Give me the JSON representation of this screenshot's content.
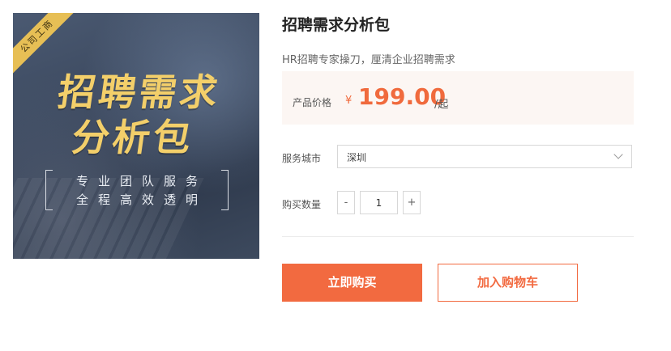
{
  "product": {
    "title": "招聘需求分析包",
    "subtitle": "HR招聘专家操刀，厘清企业招聘需求",
    "image": {
      "ribbon_text": "公司工商",
      "headline_line1": "招聘需求",
      "headline_line2": "分析包",
      "tagline_line1": "专业团队服务",
      "tagline_line2": "全程高效透明"
    }
  },
  "price": {
    "label": "产品价格",
    "currency": "¥",
    "value": "199.00",
    "unit": "/起"
  },
  "city": {
    "label": "服务城市",
    "selected": "深圳"
  },
  "quantity": {
    "label": "购买数量",
    "minus": "-",
    "value": "1",
    "plus": "+"
  },
  "actions": {
    "buy_now": "立即购买",
    "add_to_cart": "加入购物车"
  },
  "colors": {
    "accent": "#f26a40",
    "price_bg": "#fcf6f3",
    "headline_gold": "#f3cf6a"
  }
}
